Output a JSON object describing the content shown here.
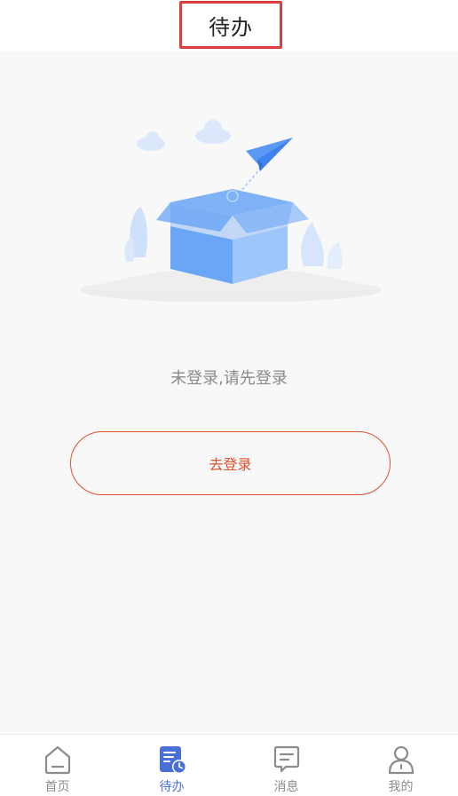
{
  "header": {
    "title": "待办"
  },
  "empty_state": {
    "message": "未登录,请先登录",
    "login_button_label": "去登录"
  },
  "tabbar": {
    "items": [
      {
        "label": "首页",
        "icon": "home-icon",
        "active": false
      },
      {
        "label": "待办",
        "icon": "todo-clock-icon",
        "active": true
      },
      {
        "label": "消息",
        "icon": "message-icon",
        "active": false
      },
      {
        "label": "我的",
        "icon": "user-icon",
        "active": false
      }
    ]
  },
  "colors": {
    "accent": "#e0502d",
    "tab_active": "#4a6fd8",
    "tab_inactive": "#8c8c8c",
    "highlight_border": "#d9423c",
    "background": "#f8f8f8"
  }
}
